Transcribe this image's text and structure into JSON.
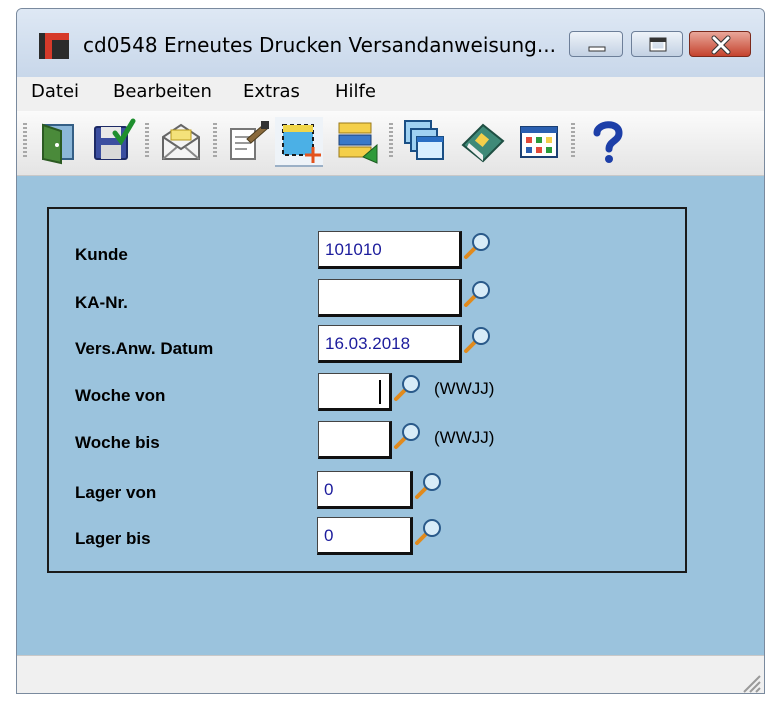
{
  "window": {
    "title": "cd0548 Erneutes Drucken Versandanweisung...",
    "app_icon": "app-icon",
    "buttons": [
      "minimize-icon",
      "maximize-icon",
      "close-icon"
    ]
  },
  "menu": {
    "items": [
      "Datei",
      "Bearbeiten",
      "Extras",
      "Hilfe"
    ]
  },
  "toolbar": {
    "icons": [
      "exit-door-icon",
      "save-icon",
      "email-icon",
      "edit-document-icon",
      "new-record-icon",
      "transfer-list-icon",
      "windows-icon",
      "book-icon",
      "grid-view-icon",
      "help-icon"
    ]
  },
  "form": {
    "kunde": {
      "label": "Kunde",
      "value": "101010"
    },
    "ka_nr": {
      "label": "KA-Nr.",
      "value": ""
    },
    "datum": {
      "label": "Vers.Anw. Datum",
      "value": "16.03.2018"
    },
    "woche_von": {
      "label": "Woche von",
      "value": "",
      "hint": "(WWJJ)"
    },
    "woche_bis": {
      "label": "Woche bis",
      "value": "",
      "hint": "(WWJJ)"
    },
    "lager_von": {
      "label": "Lager von",
      "value": "0"
    },
    "lager_bis": {
      "label": "Lager bis",
      "value": "0"
    }
  },
  "colors": {
    "main_background": "#9bc3dd",
    "field_text": "#1c1c9c"
  }
}
